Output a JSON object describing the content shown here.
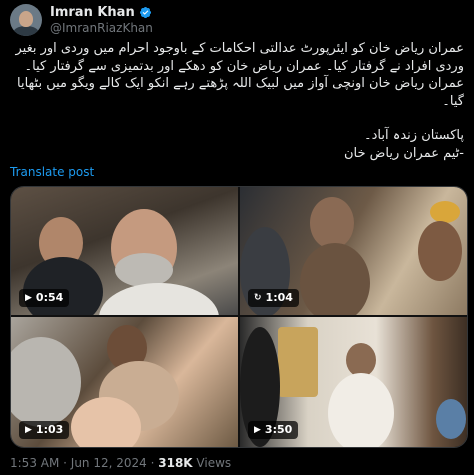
{
  "author": {
    "name": "Imran Khan",
    "handle": "@ImranRiazKhan"
  },
  "post": {
    "paragraph1": "عمران ریاض خان کو ایئرپورٹ عدالتی احکامات کے باوجود احرام میں وردی اور بغیر وردی افراد نے گرفتار کیا۔ عمران ریاض خان کو دھکے اور بدتمیزی سے گرفتار کیا۔ عمران ریاض خان اونچی آواز میں لبیک اللہ پڑھتے رہے انکو ایک کالے ویگو میں بٹھایا گیا۔",
    "paragraph2_line1": "پاکستان زندہ آباد۔",
    "paragraph2_line2": "-ٹیم عمران ریاض خان",
    "translate_label": "Translate post"
  },
  "media": [
    {
      "duration": "0:54",
      "icon": "play-icon"
    },
    {
      "duration": "1:04",
      "icon": "replay-icon"
    },
    {
      "duration": "1:03",
      "icon": "play-icon"
    },
    {
      "duration": "3:50",
      "icon": "play-icon"
    }
  ],
  "footer": {
    "time": "1:53 AM",
    "sep1": " · ",
    "date": "Jun 12, 2024",
    "sep2": " · ",
    "views_count": "318K",
    "views_label": " Views"
  },
  "colors": {
    "accent": "#1d9bf0",
    "muted": "#71767b",
    "text": "#e7e9ea",
    "background": "#000000"
  }
}
